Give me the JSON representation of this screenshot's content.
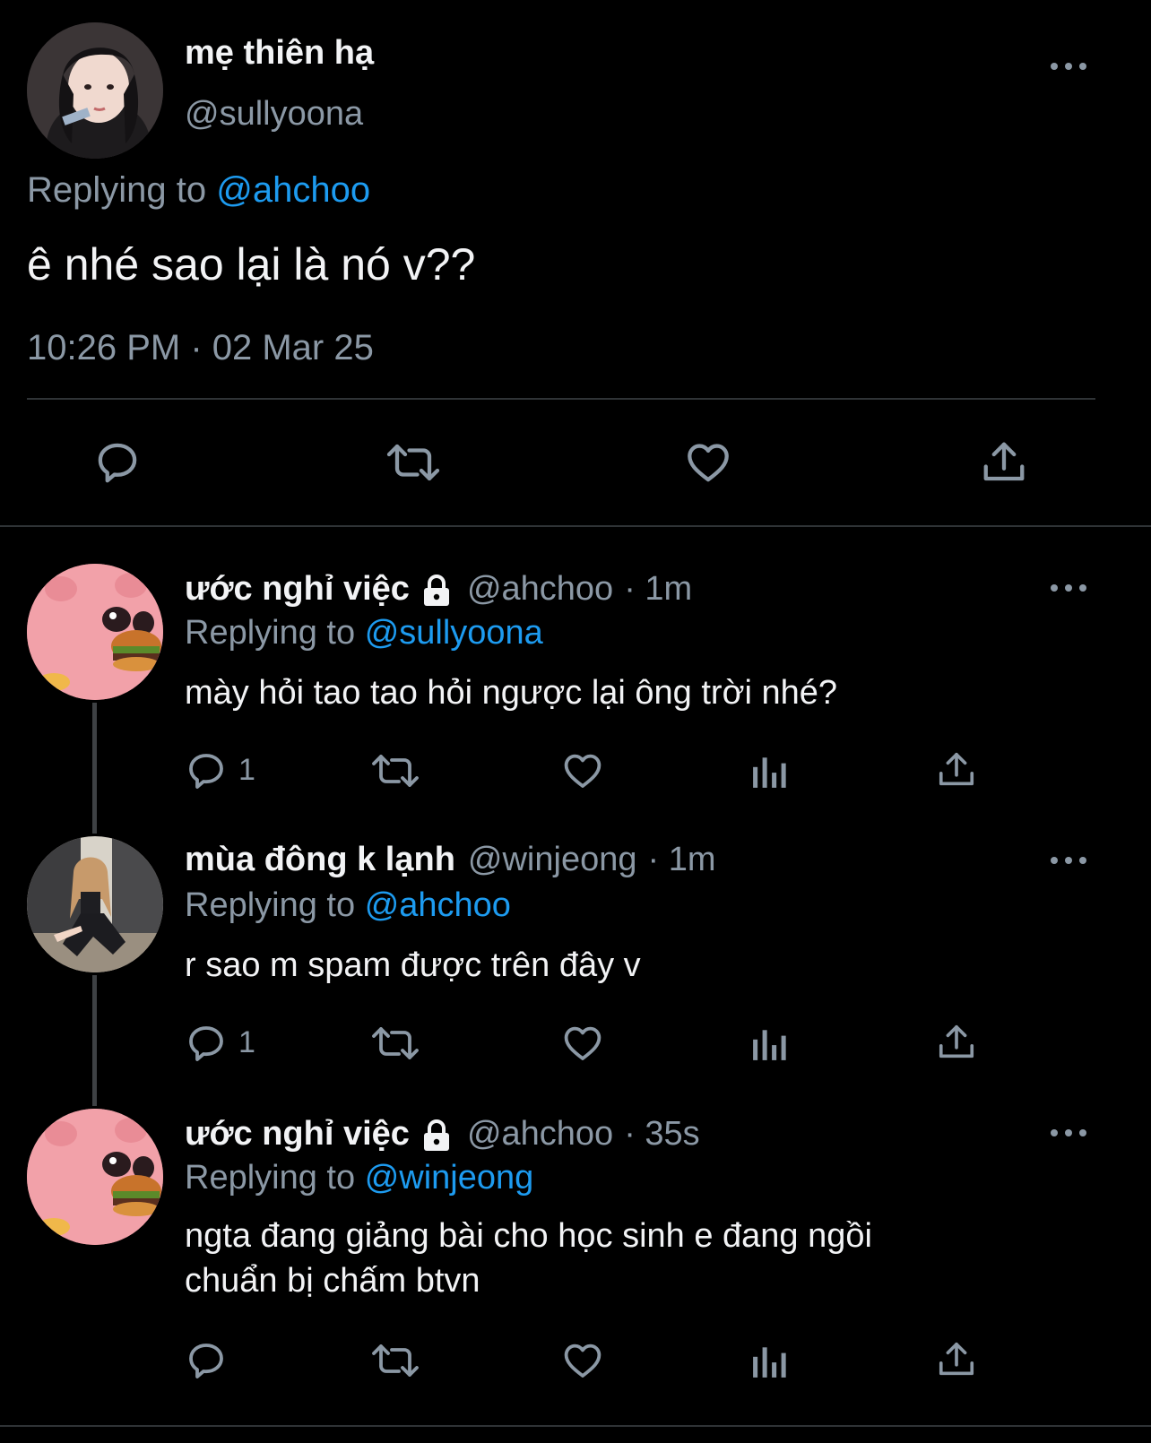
{
  "main_tweet": {
    "display_name": "mẹ thiên hạ",
    "handle": "@sullyoona",
    "replying_prefix": "Replying to",
    "replying_to": "@ahchoo",
    "text": "ê nhé sao lại là nó v??",
    "timestamp": "10:26 PM · 02 Mar 25"
  },
  "replies": [
    {
      "display_name": "ước nghỉ việc",
      "handle": "@ahchoo",
      "time": "· 1m",
      "replying_prefix": "Replying to",
      "replying_to": "@sullyoona",
      "text_lines": [
        "mày hỏi tao tao hỏi ngược lại ông trời nhé?"
      ],
      "reply_count": "1"
    },
    {
      "display_name": "mùa đông k lạnh",
      "handle": "@winjeong",
      "time": "· 1m",
      "replying_prefix": "Replying to",
      "replying_to": "@ahchoo",
      "text_lines": [
        "r sao m spam được trên đây v"
      ],
      "reply_count": "1"
    },
    {
      "display_name": "ước nghỉ việc",
      "handle": "@ahchoo",
      "time": "· 35s",
      "replying_prefix": "Replying to",
      "replying_to": "@winjeong",
      "text_lines": [
        "ngta đang giảng bài cho học sinh e đang ngồi",
        "chuẩn bị chấm btvn"
      ],
      "reply_count": ""
    }
  ],
  "colors": {
    "background": "#000000",
    "text": "#f2f3f5",
    "secondary": "#8b98a5",
    "link": "#1d9bf0",
    "divider": "#2f3336"
  }
}
